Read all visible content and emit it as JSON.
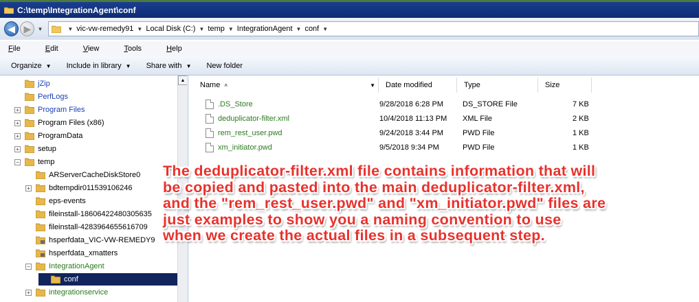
{
  "window": {
    "title": "C:\\temp\\IntegrationAgent\\conf"
  },
  "address": {
    "crumbs": [
      "vic-vw-remedy91",
      "Local Disk (C:)",
      "temp",
      "IntegrationAgent",
      "conf"
    ]
  },
  "menu": [
    "File",
    "Edit",
    "View",
    "Tools",
    "Help"
  ],
  "menu_underline": [
    "F",
    "E",
    "V",
    "T",
    "H"
  ],
  "toolbar": {
    "organize": "Organize",
    "include": "Include in library",
    "share": "Share with",
    "newfolder": "New folder"
  },
  "tree": [
    {
      "label": "jZip",
      "color": "blue",
      "expander": "",
      "icon": "folder"
    },
    {
      "label": "PerfLogs",
      "color": "blue",
      "expander": "",
      "icon": "folder"
    },
    {
      "label": "Program Files",
      "color": "blue",
      "expander": "+",
      "icon": "folder"
    },
    {
      "label": "Program Files (x86)",
      "color": "black",
      "expander": "+",
      "icon": "folder"
    },
    {
      "label": "ProgramData",
      "color": "black",
      "expander": "+",
      "icon": "folder"
    },
    {
      "label": "setup",
      "color": "black",
      "expander": "+",
      "icon": "folder"
    },
    {
      "label": "temp",
      "color": "black",
      "expander": "−",
      "icon": "folder"
    },
    {
      "label": "ARServerCacheDiskStore0",
      "color": "black",
      "expander": "",
      "icon": "folder"
    },
    {
      "label": "bdtempdir011539106246",
      "color": "black",
      "expander": "+",
      "icon": "folder"
    },
    {
      "label": "eps-events",
      "color": "black",
      "expander": "",
      "icon": "folder"
    },
    {
      "label": "fileinstall-18606422480305635",
      "color": "black",
      "expander": "",
      "icon": "folder"
    },
    {
      "label": "fileinstall-4283964655616709",
      "color": "black",
      "expander": "",
      "icon": "folder"
    },
    {
      "label": "hsperfdata_VIC-VW-REMEDY9",
      "color": "black",
      "expander": "",
      "icon": "folder-locked"
    },
    {
      "label": "hsperfdata_xmatters",
      "color": "black",
      "expander": "",
      "icon": "folder-locked"
    },
    {
      "label": "IntegrationAgent",
      "color": "green",
      "expander": "−",
      "icon": "folder"
    },
    {
      "label": "conf",
      "color": "white",
      "expander": "",
      "icon": "folder",
      "selected": true
    },
    {
      "label": "integrationservice",
      "color": "green",
      "expander": "+",
      "icon": "folder"
    }
  ],
  "columns": {
    "name": "Name",
    "date": "Date modified",
    "type": "Type",
    "size": "Size"
  },
  "files": [
    {
      "name": ".DS_Store",
      "date": "9/28/2018 6:28 PM",
      "type": "DS_STORE File",
      "size": "7 KB"
    },
    {
      "name": "deduplicator-filter.xml",
      "date": "10/4/2018 11:13 PM",
      "type": "XML File",
      "size": "2 KB"
    },
    {
      "name": "rem_rest_user.pwd",
      "date": "9/24/2018 3:44 PM",
      "type": "PWD File",
      "size": "1 KB"
    },
    {
      "name": "xm_initiator.pwd",
      "date": "9/5/2018 9:34 PM",
      "type": "PWD File",
      "size": "1 KB"
    }
  ],
  "annotation": {
    "lines": [
      "The deduplicator-filter.xml file contains information that will",
      "be copied and pasted into the main deduplicator-filter.xml,",
      "and the \"rem_rest_user.pwd\" and \"xm_initiator.pwd\" files are",
      "just examples to show you a naming convention to use",
      "when we create the actual files in a subsequent step."
    ]
  },
  "colors": {
    "title_bar": "#0e2c73",
    "selection": "#12245c",
    "annotation_text": "#e8322d",
    "link_blue": "#1a3fb5",
    "link_green": "#2a7a1e",
    "folder": "#e8b74a"
  }
}
